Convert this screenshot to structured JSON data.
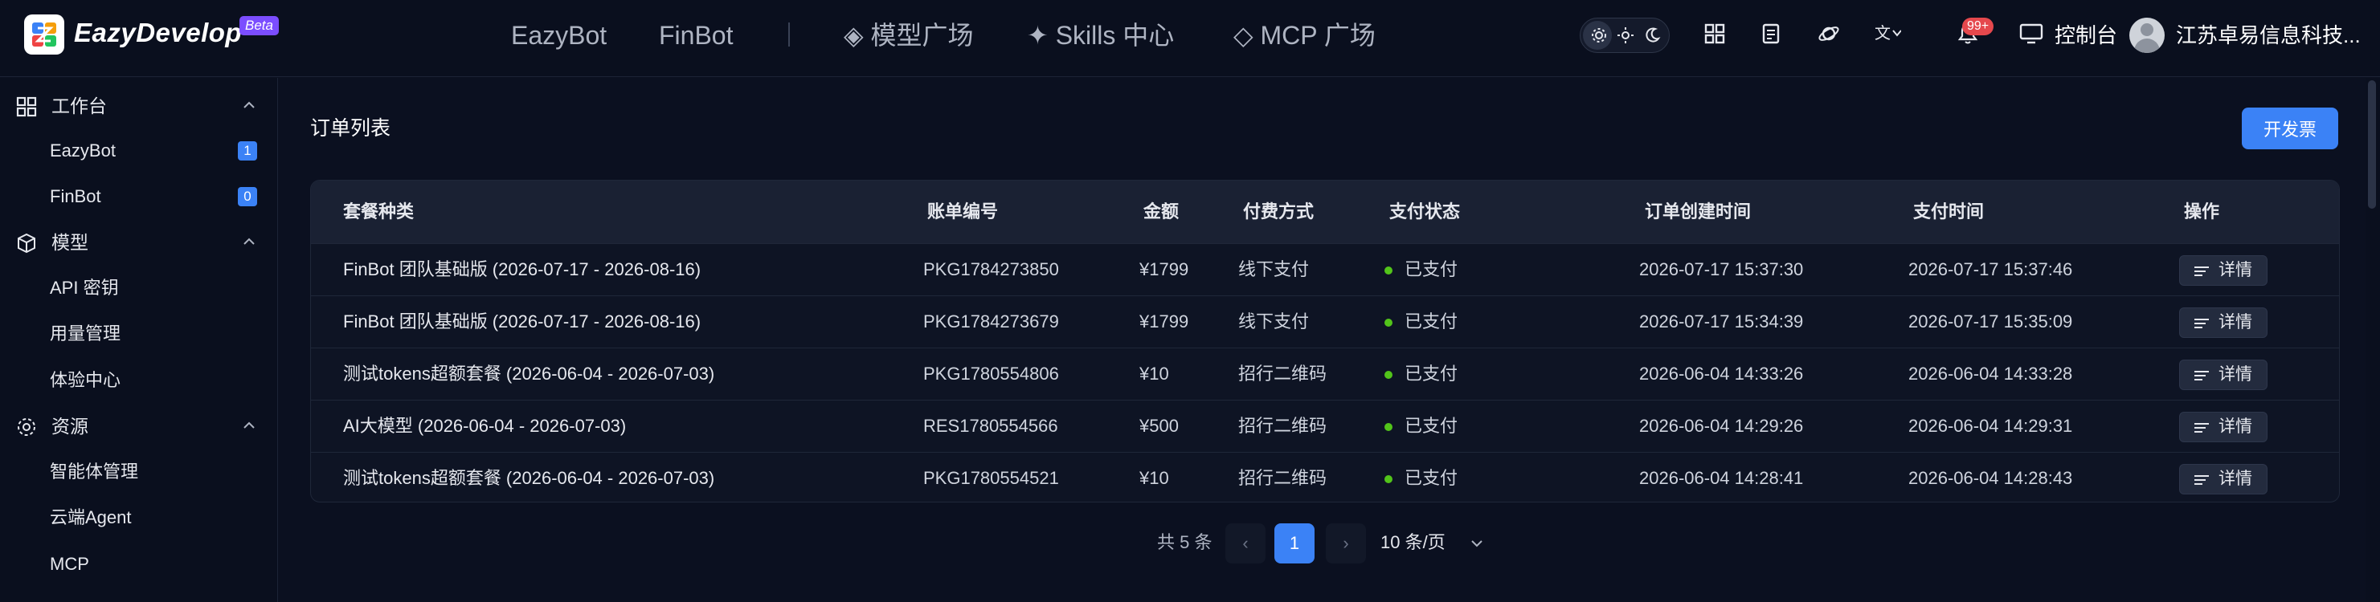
{
  "header": {
    "brand": "EazyDevelop",
    "beta": "Beta",
    "nav": [
      "EazyBot",
      "FinBot"
    ],
    "nav_right": [
      "◈ 模型广场",
      "✦ Skills 中心",
      "◇ MCP 广场"
    ],
    "notifications": "99+",
    "console": "控制台",
    "company": "江苏卓易信息科技..."
  },
  "sidebar": {
    "groups": [
      {
        "label": "工作台",
        "icon": "grid-icon",
        "items": [
          {
            "label": "EazyBot",
            "count": "1"
          },
          {
            "label": "FinBot",
            "count": "0"
          }
        ]
      },
      {
        "label": "模型",
        "icon": "cube-icon",
        "items": [
          {
            "label": "API 密钥"
          },
          {
            "label": "用量管理"
          },
          {
            "label": "体验中心"
          }
        ]
      },
      {
        "label": "资源",
        "icon": "gear-icon",
        "items": [
          {
            "label": "智能体管理"
          },
          {
            "label": "云端Agent"
          },
          {
            "label": "MCP"
          }
        ]
      }
    ]
  },
  "main": {
    "title": "订单列表",
    "invoice_button": "开发票",
    "columns": [
      "套餐种类",
      "账单编号",
      "金额",
      "付费方式",
      "支付状态",
      "订单创建时间",
      "支付时间",
      "操作"
    ],
    "rows": [
      {
        "package": "FinBot 团队基础版 (2026-07-17 - 2026-08-16)",
        "bill_no": "PKG1784273850",
        "amount": "¥1799",
        "method": "线下支付",
        "status": "已支付",
        "created": "2026-07-17 15:37:30",
        "paid": "2026-07-17 15:37:46",
        "action": "详情"
      },
      {
        "package": "FinBot 团队基础版 (2026-07-17 - 2026-08-16)",
        "bill_no": "PKG1784273679",
        "amount": "¥1799",
        "method": "线下支付",
        "status": "已支付",
        "created": "2026-07-17 15:34:39",
        "paid": "2026-07-17 15:35:09",
        "action": "详情"
      },
      {
        "package": "测试tokens超额套餐 (2026-06-04 - 2026-07-03)",
        "bill_no": "PKG1780554806",
        "amount": "¥10",
        "method": "招行二维码",
        "status": "已支付",
        "created": "2026-06-04 14:33:26",
        "paid": "2026-06-04 14:33:28",
        "action": "详情"
      },
      {
        "package": "AI大模型 (2026-06-04 - 2026-07-03)",
        "bill_no": "RES1780554566",
        "amount": "¥500",
        "method": "招行二维码",
        "status": "已支付",
        "created": "2026-06-04 14:29:26",
        "paid": "2026-06-04 14:29:31",
        "action": "详情"
      },
      {
        "package": "测试tokens超额套餐 (2026-06-04 - 2026-07-03)",
        "bill_no": "PKG1780554521",
        "amount": "¥10",
        "method": "招行二维码",
        "status": "已支付",
        "created": "2026-06-04 14:28:41",
        "paid": "2026-06-04 14:28:43",
        "action": "详情"
      }
    ],
    "status_color": "#52c41a",
    "accent_color": "#3b82f6"
  },
  "pagination": {
    "total": "共 5 条",
    "prev": "‹",
    "current": "1",
    "next": "›",
    "page_size": "10 条/页"
  }
}
